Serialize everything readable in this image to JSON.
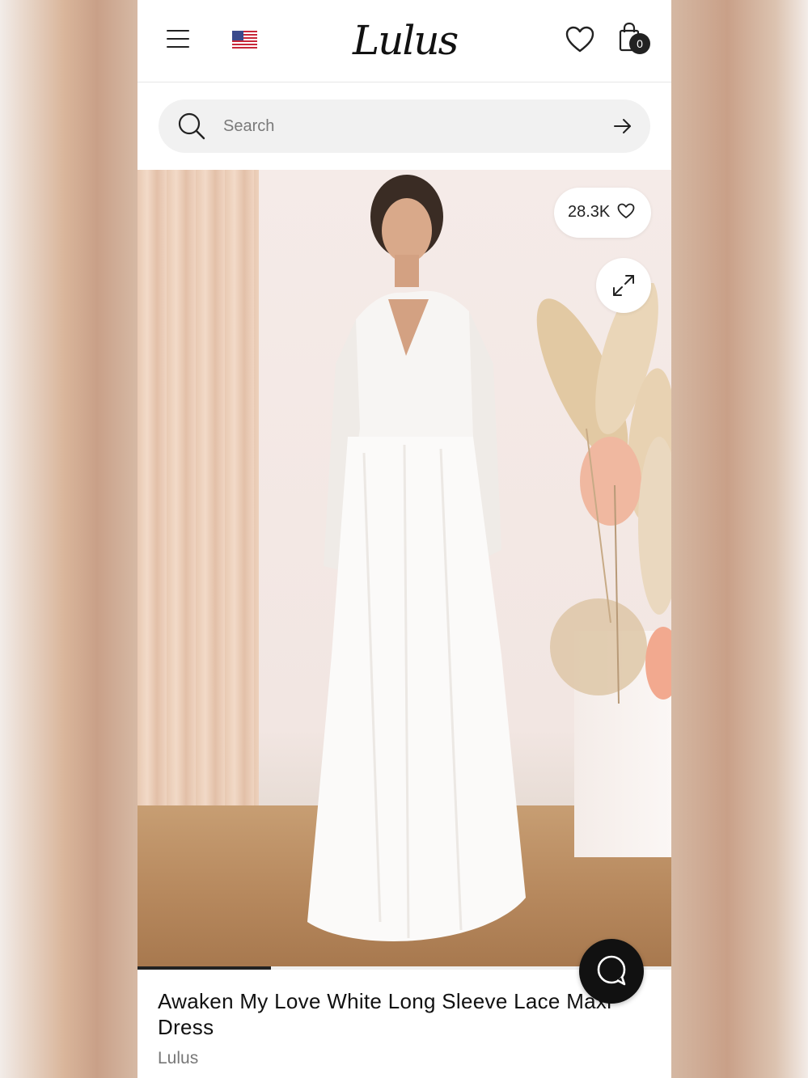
{
  "header": {
    "logo_text": "Lulus",
    "menu_icon": "hamburger-menu-icon",
    "flag_icon": "us-flag-icon",
    "wishlist_icon": "heart-icon",
    "cart_icon": "shopping-bag-icon",
    "cart_count": "0"
  },
  "search": {
    "placeholder": "Search",
    "value": "",
    "submit_icon": "arrow-right-icon"
  },
  "product": {
    "likes": "28.3K",
    "image_progress": 0.25,
    "title": "Awaken My Love White Long Sleeve Lace Maxi Dress",
    "brand": "Lulus"
  },
  "chat": {
    "icon": "chat-bubble-icon"
  },
  "colors": {
    "accent": "#111111",
    "search_bg": "#f1f1f1",
    "cart_badge": "#222222"
  }
}
